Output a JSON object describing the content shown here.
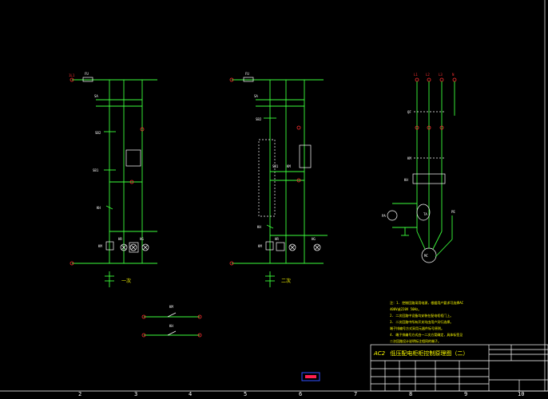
{
  "drawing": {
    "title_code": "AC2",
    "title": "低压配电柜柜控制原理图（二）",
    "caption_variant_1": "一次",
    "caption_variant_2": "二次"
  },
  "notes": [
    "注：1. 控制回路采用电源，根据用户要求可选择AC",
    "   400V或220V 50Hz。",
    "2. 二次回路中设备均安装在配电柜柜门上。",
    "3. 二次回路中所有开关均由用户另行选择。",
    "   端子排编号方式采用元器件标号原则。",
    "4. 端子排编号方式由一二次方案确定，具体标签见",
    "   二次回路设计说明标注相同的端子。"
  ],
  "border_numbers": [
    "2",
    "3",
    "4",
    "5",
    "6",
    "7",
    "8",
    "9",
    "10"
  ],
  "labels": {
    "fu": "FU",
    "sa": "SA",
    "sb1": "SB1",
    "sb2": "SB2",
    "km": "KM",
    "kh": "KH",
    "hr": "HR",
    "hg": "HG",
    "qf": "QF",
    "ta": "TA",
    "pa": "PA",
    "mc": "MC",
    "pe": "PE",
    "l1": "L1",
    "l2": "L2",
    "l3": "L3",
    "n": "N"
  },
  "colors": {
    "background": "#000000",
    "wire": "#3cff3c",
    "label": "#ff3030",
    "note": "#ffff00",
    "frame": "#ffffff"
  }
}
